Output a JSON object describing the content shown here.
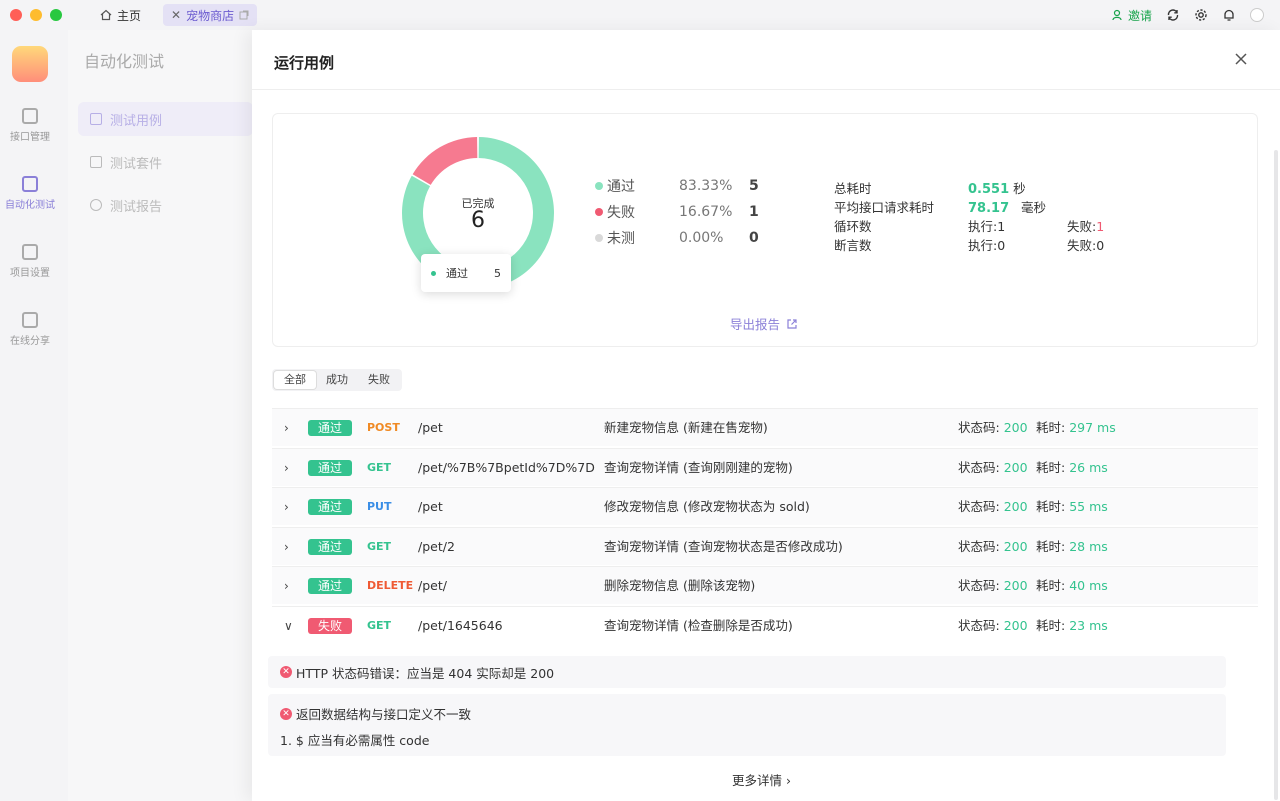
{
  "colors": {
    "pass": "#34c38f",
    "fail": "#f05a72",
    "untested": "#d9d9d9",
    "accent": "#8b80d8"
  },
  "titlebar": {
    "tabs": [
      {
        "label": "主页",
        "icon": "home-icon"
      },
      {
        "label": "宠物商店",
        "icon": "external-icon"
      }
    ],
    "invite_label": "邀请"
  },
  "rail": {
    "items": [
      {
        "label": "接口管理",
        "icon": "api-icon"
      },
      {
        "label": "自动化测试",
        "icon": "automation-icon"
      },
      {
        "label": "项目设置",
        "icon": "settings-icon"
      },
      {
        "label": "在线分享",
        "icon": "share-icon"
      }
    ]
  },
  "subnav": {
    "title": "自动化测试",
    "items": [
      {
        "label": "测试用例",
        "icon": "testcase-icon"
      },
      {
        "label": "测试套件",
        "icon": "suite-icon"
      },
      {
        "label": "测试报告",
        "icon": "report-icon"
      }
    ]
  },
  "drawer": {
    "title": "运行用例"
  },
  "summary": {
    "center_label": "已完成",
    "center_value": "6",
    "tooltip": {
      "label": "通过",
      "value": "5"
    },
    "legend": [
      {
        "name": "通过",
        "percent": "83.33%",
        "count": "5",
        "color": "#8ae3bf"
      },
      {
        "name": "失败",
        "percent": "16.67%",
        "count": "1",
        "color": "#f67a90"
      },
      {
        "name": "未测",
        "percent": "0.00%",
        "count": "0",
        "color": "#d9d9d9"
      }
    ],
    "stats": {
      "total_label": "总耗时",
      "total_value": "0.551",
      "total_unit": "秒",
      "avg_label": "平均接口请求耗时",
      "avg_value": "78.17",
      "avg_unit": "毫秒",
      "loop_label": "循环数",
      "loop_exec": "执行:1",
      "loop_fail_label": "失败:",
      "loop_fail_value": "1",
      "assert_label": "断言数",
      "assert_exec": "执行:0",
      "assert_fail": "失败:0"
    },
    "export_label": "导出报告"
  },
  "filters": [
    "全部",
    "成功",
    "失败"
  ],
  "chart_data": {
    "type": "pie",
    "categories": [
      "通过",
      "失败",
      "未测"
    ],
    "values": [
      5,
      1,
      0
    ]
  },
  "status_code_label": "状态码:",
  "cost_label": "耗时:",
  "cases": [
    {
      "result": "通过",
      "method": "POST",
      "method_color": "#f08a24",
      "path": "/pet",
      "desc": "新建宠物信息 (新建在售宠物)",
      "code": "200",
      "time": "297 ms",
      "expanded": false
    },
    {
      "result": "通过",
      "method": "GET",
      "method_color": "#34c38f",
      "path": "/pet/%7B%7BpetId%7D%7D",
      "desc": "查询宠物详情 (查询刚刚建的宠物)",
      "code": "200",
      "time": "26 ms",
      "expanded": false
    },
    {
      "result": "通过",
      "method": "PUT",
      "method_color": "#3a8ee6",
      "path": "/pet",
      "desc": "修改宠物信息 (修改宠物状态为 sold)",
      "code": "200",
      "time": "55 ms",
      "expanded": false
    },
    {
      "result": "通过",
      "method": "GET",
      "method_color": "#34c38f",
      "path": "/pet/2",
      "desc": "查询宠物详情 (查询宠物状态是否修改成功)",
      "code": "200",
      "time": "28 ms",
      "expanded": false
    },
    {
      "result": "通过",
      "method": "DELETE",
      "method_color": "#ef5a34",
      "path": "/pet/",
      "desc": "删除宠物信息 (删除该宠物)",
      "code": "200",
      "time": "40 ms",
      "expanded": false
    },
    {
      "result": "失败",
      "method": "GET",
      "method_color": "#34c38f",
      "path": "/pet/1645646",
      "desc": "查询宠物详情 (检查删除是否成功)",
      "code": "200",
      "time": "23 ms",
      "expanded": true
    }
  ],
  "errors": {
    "first": "HTTP 状态码错误：应当是 404 实际却是 200",
    "second_title": "返回数据结构与接口定义不一致",
    "second_detail": "1. $ 应当有必需属性 code"
  },
  "more_label": "更多详情"
}
